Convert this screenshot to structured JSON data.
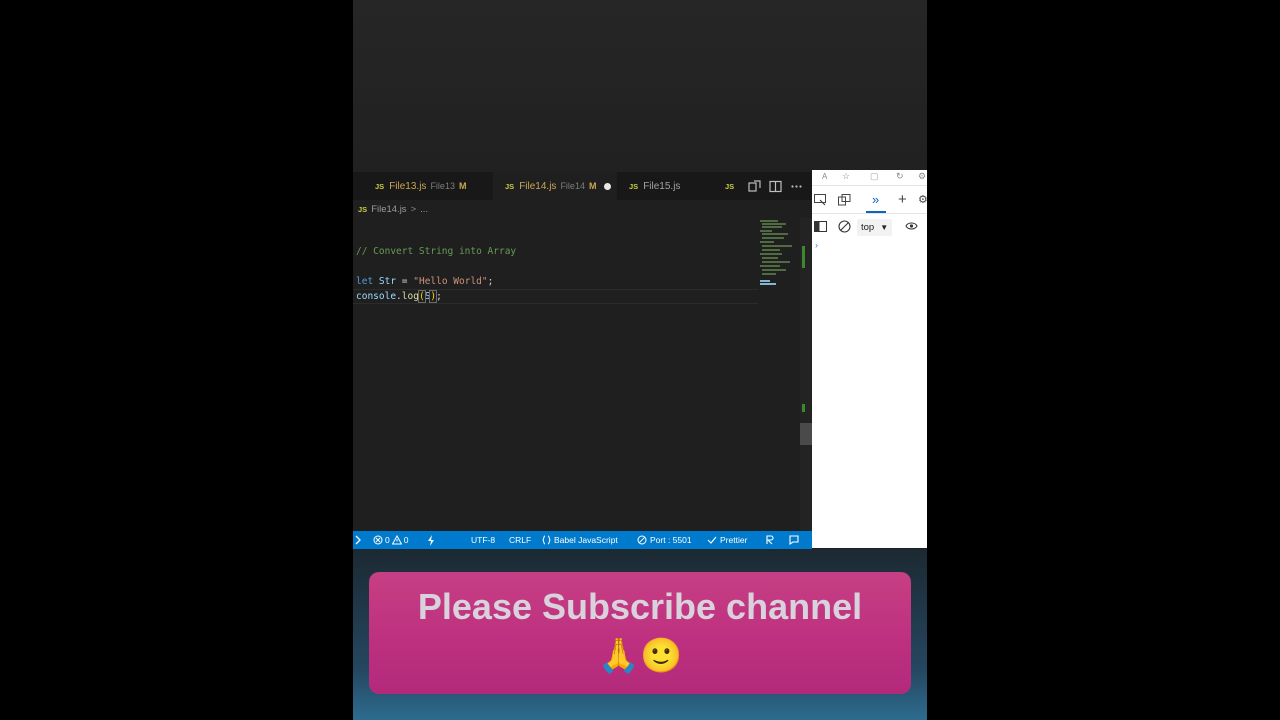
{
  "tabs": [
    {
      "name": "File13.js",
      "desc": "File13",
      "mod": "M"
    },
    {
      "name": "File14.js",
      "desc": "File14",
      "mod": "M"
    },
    {
      "name": "File15.js"
    }
  ],
  "tab_badge": "JS",
  "breadcrumb": {
    "file": "File14.js",
    "sep": ">",
    "rest": "..."
  },
  "code": {
    "comment": "// Convert String into Array",
    "kw_let": "let",
    "var_name": "Str",
    "eq": " = ",
    "string": "\"Hello World\"",
    "semi": ";",
    "console": "console",
    "dot": ".",
    "log": "log",
    "open": "(",
    "arg": "S",
    "close": ")",
    "end": ";"
  },
  "statusbar": {
    "errors": "0",
    "warnings": "0",
    "encoding": "UTF-8",
    "eol": "CRLF",
    "language": "Babel JavaScript",
    "port": "Port : 5501",
    "prettier": "Prettier"
  },
  "devtools": {
    "context": "top"
  },
  "banner": {
    "text": "Please Subscribe channel",
    "emoji": "🙏🙂"
  },
  "colors": {
    "statusbar": "#007acc",
    "banner": "#c63f84"
  }
}
